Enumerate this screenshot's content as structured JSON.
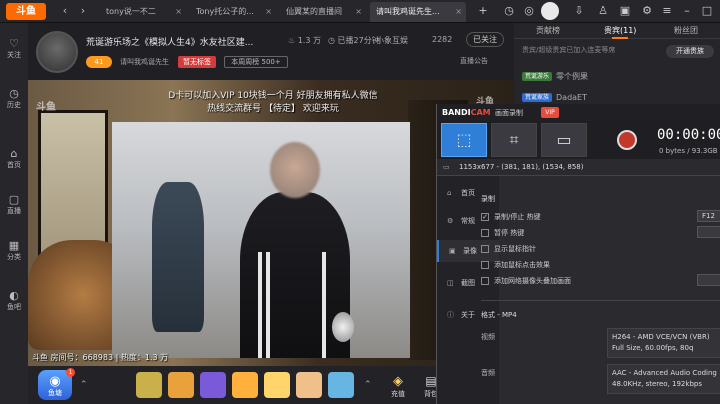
{
  "tabs": [
    {
      "label": "tony说一不二"
    },
    {
      "label": "Tony托公子的..."
    },
    {
      "label": "仙翼某的直播间"
    },
    {
      "label": "请叫我鸡诞先生..."
    }
  ],
  "sidebar": [
    {
      "icon": "heart-icon",
      "label": "关注"
    },
    {
      "icon": "clock-icon",
      "label": "历史"
    },
    {
      "icon": "home-icon",
      "label": "首页"
    },
    {
      "icon": "tv-icon",
      "label": "直播"
    },
    {
      "icon": "grid-icon",
      "label": "分类"
    },
    {
      "icon": "fish-icon",
      "label": "鱼吧"
    }
  ],
  "room": {
    "title": "荒诞游乐场之《模拟人生4》水友社区建...",
    "hot": "1.3 万",
    "subscribed": "已播27分钟",
    "shop": "小象互娱",
    "fans_count": "2282",
    "follow_label": "已关注",
    "level": "41",
    "host": "请叫我鸡诞先生",
    "tag_hot": "暂无标签",
    "tag_rank": "本周周榜 500+",
    "notice": "直播公告"
  },
  "video": {
    "overlay_line1": "D卡可以加入VIP 10块钱一个月 好朋友拥有私人微信",
    "overlay_line2": "热线交流群号 【待定】 欢迎来玩",
    "watermark_left": "斗鱼",
    "watermark_right": "斗鱼",
    "room_info": "斗鱼 房间号：668983 | 热度：1.3 万"
  },
  "giftbar": {
    "fish_label": "鱼塘",
    "fish_badge": "1",
    "charge_label": "充值",
    "backpack_label": "背包",
    "gift_colors": [
      "#c9b04a",
      "#e9a23b",
      "#7a5ad8",
      "#ffb13c",
      "#ffd46a",
      "#f0c08a",
      "#66b5e3"
    ]
  },
  "rightpanel": {
    "tab_contrib": "贡献榜",
    "tab_nobles": "贵宾(11)",
    "tab_fans": "粉丝团",
    "fans_note": "贵宾/超级贵宾已加入连麦等席",
    "open_guard": "开通贵族",
    "chat1_badge": "荒诞游乐",
    "chat1_text": "零个例果",
    "chat2_badge": "荒诞家族",
    "chat2_text": "DadaET"
  },
  "bandicam": {
    "logo_a": "BANDI",
    "logo_b": "CAM",
    "mode": "画面录制",
    "vip": "VIP",
    "timer": "00:00:00",
    "size": "0 bytes / 93.3GB",
    "resolution": "1153x677 - (381, 181), (1534, 858)",
    "nav": [
      {
        "icon": "home-icon",
        "label": "首页"
      },
      {
        "icon": "gear-icon",
        "label": "常规"
      },
      {
        "icon": "video-icon",
        "label": "录像"
      },
      {
        "icon": "image-icon",
        "label": "截图"
      },
      {
        "icon": "info-icon",
        "label": "关于"
      }
    ],
    "section_record": "录制",
    "hotkey_label": "录制/停止 热键",
    "hotkey_value": "F12",
    "pause_label": "暂停 热键",
    "cursor_label": "显示鼠标指针",
    "click_label": "添加鼠标点击效果",
    "webcam_label": "添加网络摄像头叠加画面",
    "format_section": "格式 - MP4",
    "video_label": "视频",
    "video_line1": "H264 - AMD VCE/VCN (VBR)",
    "video_line2": "Full Size, 60.00fps, 80q",
    "audio_label": "音频",
    "audio_line1": "AAC - Advanced Audio Coding",
    "audio_line2": "48.0KHz, stereo, 192kbps"
  }
}
